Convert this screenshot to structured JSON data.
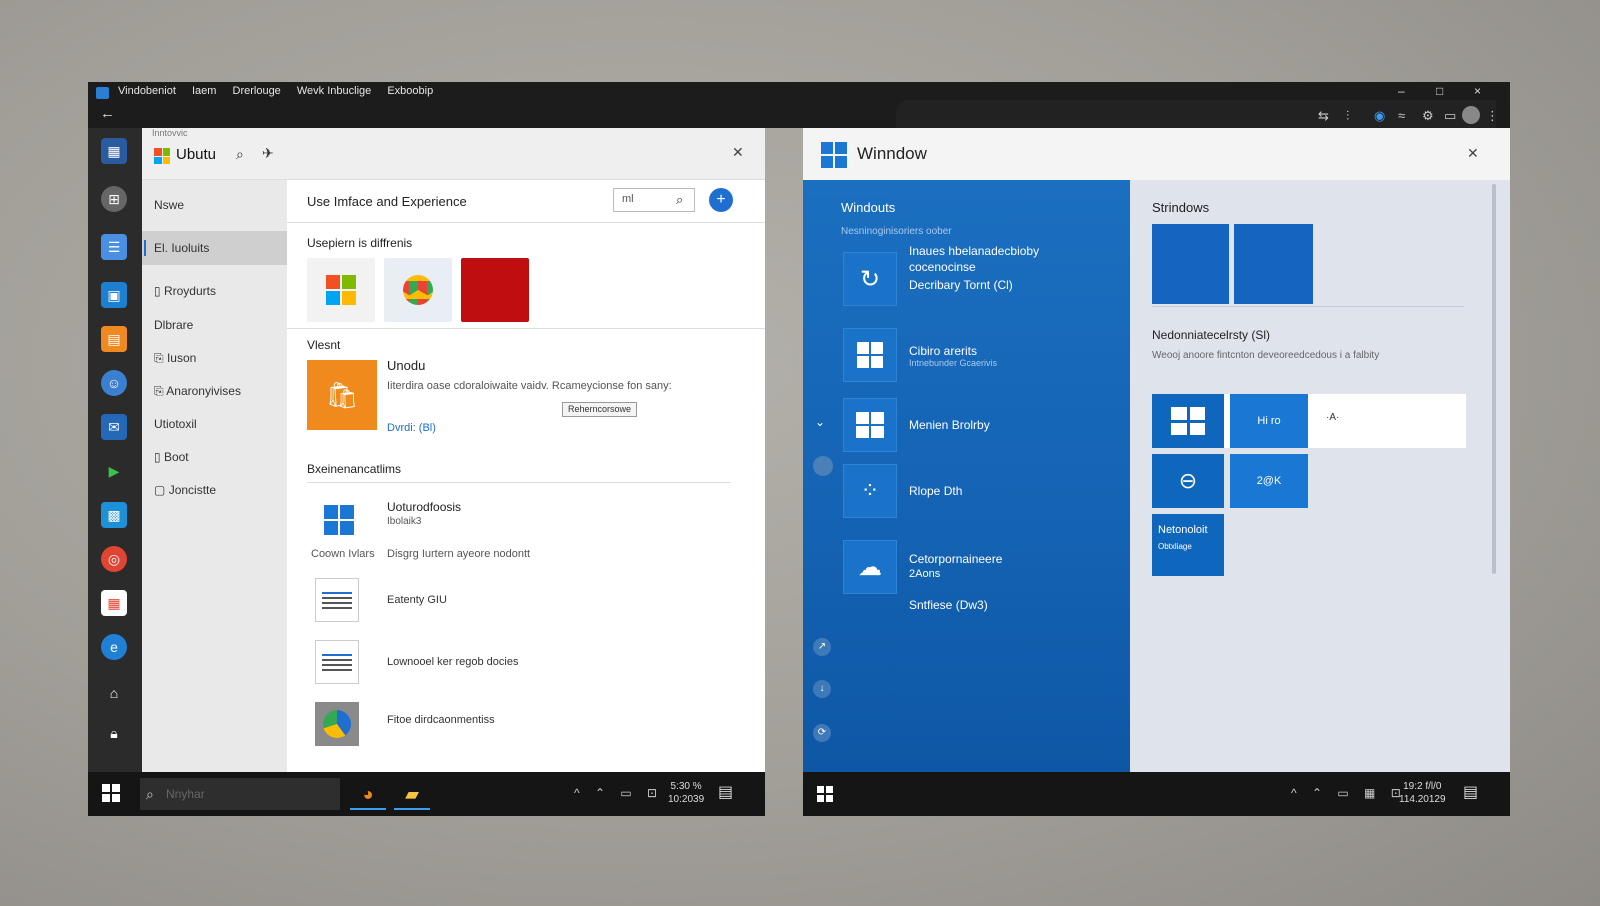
{
  "topbar": {
    "menu": [
      "Vindobeniot",
      "Iaem",
      "Drerlouge",
      "Wevk Inbuclige",
      "Exboobip"
    ],
    "window_controls": {
      "minimize": "–",
      "maximize": "□",
      "close": "×"
    }
  },
  "left": {
    "crumb": "Inntovvic",
    "title": "Ubutu",
    "nav": [
      {
        "label": "Nswe",
        "icon": ""
      },
      {
        "label": "El. Iuoluits",
        "icon": ""
      },
      {
        "label": "Rroydurts",
        "icon": "▯"
      },
      {
        "label": "Dlbrare",
        "icon": ""
      },
      {
        "label": "Iuson",
        "icon": "⎘"
      },
      {
        "label": "Anaronyivises",
        "icon": "⎘"
      },
      {
        "label": "Utiotoxil",
        "icon": ""
      },
      {
        "label": "Boot",
        "icon": "▯"
      },
      {
        "label": "Joncistte",
        "icon": "▢"
      }
    ],
    "header_title": "Use Imface and Experience",
    "search_value": "ml",
    "section1": "Usepiern is diffrenis",
    "section2": "Vlesnt",
    "feature": {
      "title": "Unodu",
      "desc": "Iiterdira oase cdoraloiwaite vaidv. Rcameycionse fon sany:",
      "button": "Reherncorsowe",
      "link": "Dvrdi: (Bl)"
    },
    "section3": "Bxeinenancatlims",
    "list": [
      {
        "title": "Uoturodfoosis",
        "sub": "Ibolaik3",
        "caption": "Coown Ivlars",
        "extra": "Disgrg Iurtern ayeore nodontt"
      },
      {
        "title": "Eatenty GIU"
      },
      {
        "title": "Lownooel ker regob docies"
      },
      {
        "title": "Fitoe dirdcaonmentiss"
      }
    ]
  },
  "left_taskbar": {
    "search_placeholder": "Nnyhar",
    "clock_time": "5:30 %",
    "clock_date": "10:2039"
  },
  "right": {
    "title": "Winndow",
    "blue": {
      "heading": "Windouts",
      "subheading": "Nesninoginisoriers oober",
      "items": [
        {
          "line1": "Inaues hbelanadecbioby",
          "line2": "cocenocinse",
          "line3": "Decribary Tornt (Cl)"
        },
        {
          "line1": "Cibiro arerits",
          "line2": "Intnebunder Gcaerivis"
        },
        {
          "line1": "Menien Brolrby"
        },
        {
          "line1": "Rlope Dth"
        },
        {
          "line1": "Cetorpornaineere",
          "line2": "2Aons",
          "line3": "Sntfiese (Dw3)"
        }
      ]
    },
    "gray": {
      "heading": "Strindows",
      "section": "Nedonniatecelrsty (Sl)",
      "section_desc": "Weooj anoore fintcnton deveoreedcedous i a falbity",
      "tiles": [
        {
          "label": ""
        },
        {
          "label": "Hi ro"
        },
        {
          "label": "·A·"
        },
        {
          "label": ""
        },
        {
          "label": "2@K"
        },
        {
          "label": "Netonoloit",
          "sub": "Obtxliage"
        }
      ]
    }
  },
  "right_taskbar": {
    "clock_time": "19:2 f/l/0",
    "clock_date": "114.20129"
  },
  "colors": {
    "accent": "#1f6fd1",
    "blue_panel": "#1462b3",
    "gray_panel": "#dee3ec",
    "taskbar": "#151515"
  }
}
